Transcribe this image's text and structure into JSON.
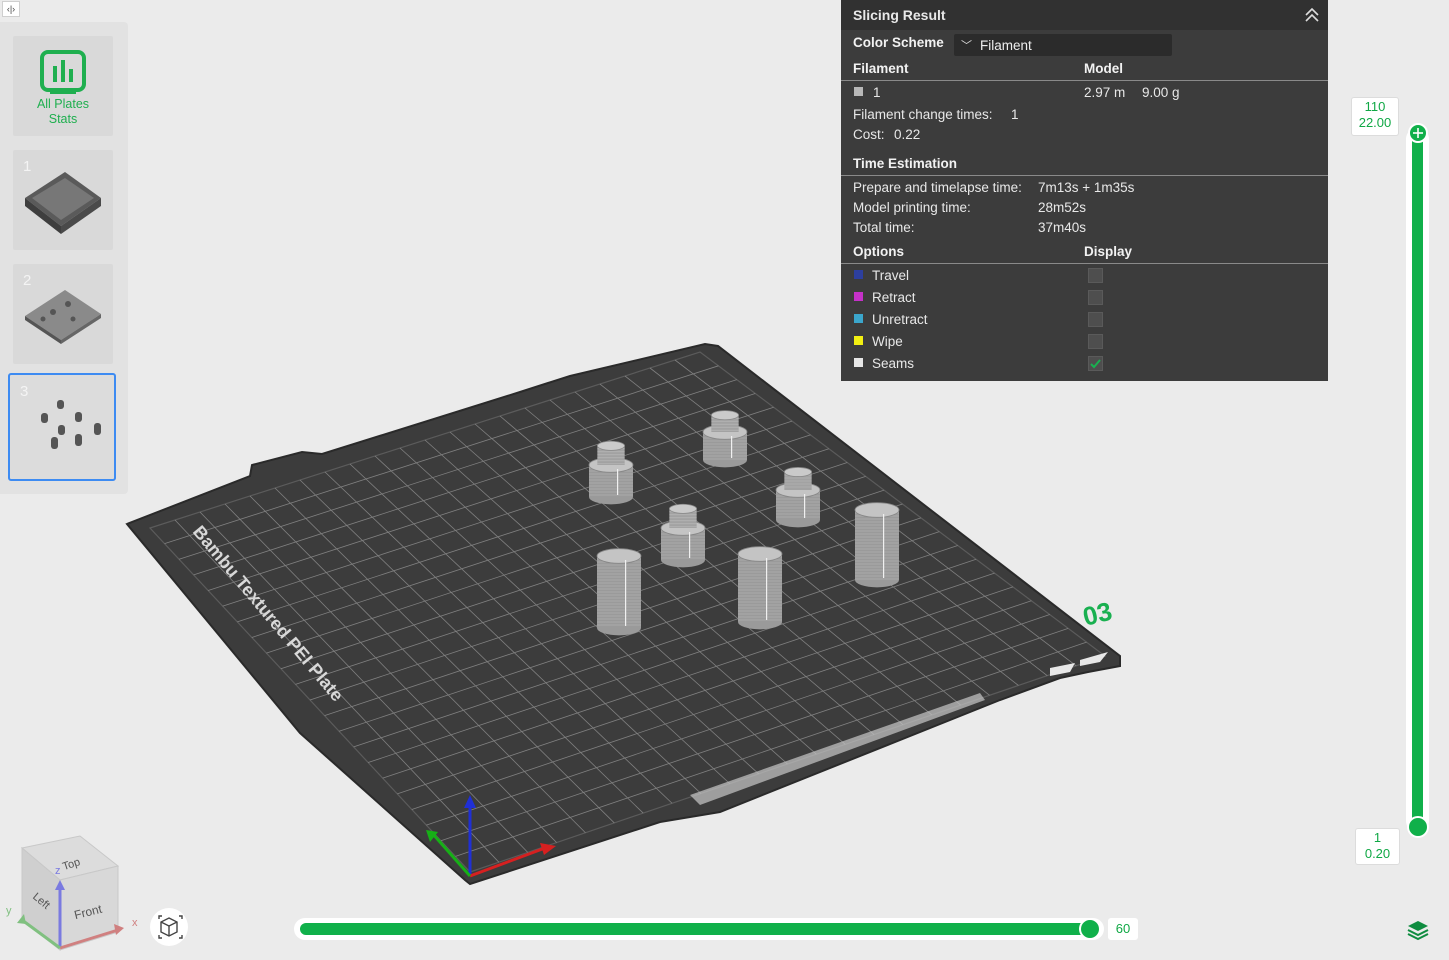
{
  "plates": {
    "stats_label_line1": "All Plates",
    "stats_label_line2": "Stats",
    "items": [
      {
        "number": "1"
      },
      {
        "number": "2"
      },
      {
        "number": "3"
      }
    ]
  },
  "viewport": {
    "bed_label": "Bambu Textured PEI Plate",
    "plate_number": "03",
    "axes": {
      "x": "x",
      "y": "y",
      "z": "z"
    },
    "cube_faces": {
      "top": "Top",
      "front": "Front",
      "left": "Left"
    }
  },
  "slicing_result": {
    "title": "Slicing Result",
    "color_scheme_label": "Color Scheme",
    "color_scheme_value": "Filament",
    "filament_header": "Filament",
    "model_header": "Model",
    "filament_row": {
      "id": "1",
      "length": "2.97 m",
      "weight": "9.00 g",
      "color": "#b8b8b8"
    },
    "change_times_label": "Filament change times:",
    "change_times_value": "1",
    "cost_label": "Cost:",
    "cost_value": "0.22",
    "time_header": "Time Estimation",
    "prepare_label": "Prepare and timelapse time:",
    "prepare_value": "7m13s + 1m35s",
    "model_time_label": "Model printing time:",
    "model_time_value": "28m52s",
    "total_label": "Total time:",
    "total_value": "37m40s",
    "options_header": "Options",
    "display_header": "Display",
    "options": [
      {
        "label": "Travel",
        "color": "#2d3f9e",
        "checked": false
      },
      {
        "label": "Retract",
        "color": "#c531c9",
        "checked": false
      },
      {
        "label": "Unretract",
        "color": "#3ba6cc",
        "checked": false
      },
      {
        "label": "Wipe",
        "color": "#f2ef12",
        "checked": false
      },
      {
        "label": "Seams",
        "color": "#e6e6e6",
        "checked": true
      }
    ]
  },
  "layer_slider": {
    "top_layer": "110",
    "top_height": "22.00",
    "bottom_layer": "1",
    "bottom_height": "0.20"
  },
  "move_slider": {
    "value": "60"
  },
  "accent": "#10b04a"
}
